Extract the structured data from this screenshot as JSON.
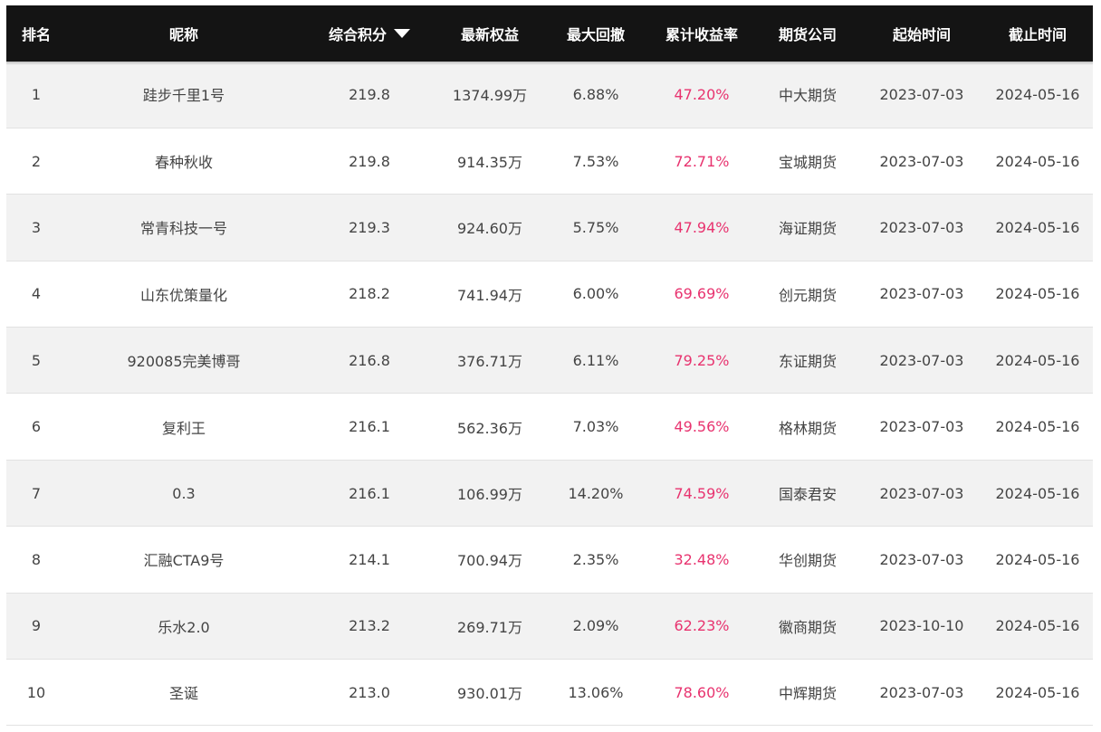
{
  "headers": {
    "rank": "排名",
    "nickname": "昵称",
    "score": "综合积分",
    "equity": "最新权益",
    "drawdown": "最大回撤",
    "return": "累计收益率",
    "company": "期货公司",
    "start": "起始时间",
    "end": "截止时间"
  },
  "sort_icon": "triangle-down-icon",
  "colors": {
    "header_bg": "#141414",
    "return_text": "#e8336f",
    "row_alt": "#f2f2f2"
  },
  "rows": [
    {
      "rank": "1",
      "nickname": "跬步千里1号",
      "score": "219.8",
      "equity": "1374.99万",
      "drawdown": "6.88%",
      "return": "47.20%",
      "company": "中大期货",
      "start": "2023-07-03",
      "end": "2024-05-16"
    },
    {
      "rank": "2",
      "nickname": "春种秋收",
      "score": "219.8",
      "equity": "914.35万",
      "drawdown": "7.53%",
      "return": "72.71%",
      "company": "宝城期货",
      "start": "2023-07-03",
      "end": "2024-05-16"
    },
    {
      "rank": "3",
      "nickname": "常青科技一号",
      "score": "219.3",
      "equity": "924.60万",
      "drawdown": "5.75%",
      "return": "47.94%",
      "company": "海证期货",
      "start": "2023-07-03",
      "end": "2024-05-16"
    },
    {
      "rank": "4",
      "nickname": "山东优策量化",
      "score": "218.2",
      "equity": "741.94万",
      "drawdown": "6.00%",
      "return": "69.69%",
      "company": "创元期货",
      "start": "2023-07-03",
      "end": "2024-05-16"
    },
    {
      "rank": "5",
      "nickname": "920085完美博哥",
      "score": "216.8",
      "equity": "376.71万",
      "drawdown": "6.11%",
      "return": "79.25%",
      "company": "东证期货",
      "start": "2023-07-03",
      "end": "2024-05-16"
    },
    {
      "rank": "6",
      "nickname": "复利王",
      "score": "216.1",
      "equity": "562.36万",
      "drawdown": "7.03%",
      "return": "49.56%",
      "company": "格林期货",
      "start": "2023-07-03",
      "end": "2024-05-16"
    },
    {
      "rank": "7",
      "nickname": "0.3",
      "score": "216.1",
      "equity": "106.99万",
      "drawdown": "14.20%",
      "return": "74.59%",
      "company": "国泰君安",
      "start": "2023-07-03",
      "end": "2024-05-16"
    },
    {
      "rank": "8",
      "nickname": "汇融CTA9号",
      "score": "214.1",
      "equity": "700.94万",
      "drawdown": "2.35%",
      "return": "32.48%",
      "company": "华创期货",
      "start": "2023-07-03",
      "end": "2024-05-16"
    },
    {
      "rank": "9",
      "nickname": "乐水2.0",
      "score": "213.2",
      "equity": "269.71万",
      "drawdown": "2.09%",
      "return": "62.23%",
      "company": "徽商期货",
      "start": "2023-10-10",
      "end": "2024-05-16"
    },
    {
      "rank": "10",
      "nickname": "圣诞",
      "score": "213.0",
      "equity": "930.01万",
      "drawdown": "13.06%",
      "return": "78.60%",
      "company": "中辉期货",
      "start": "2023-07-03",
      "end": "2024-05-16"
    }
  ]
}
